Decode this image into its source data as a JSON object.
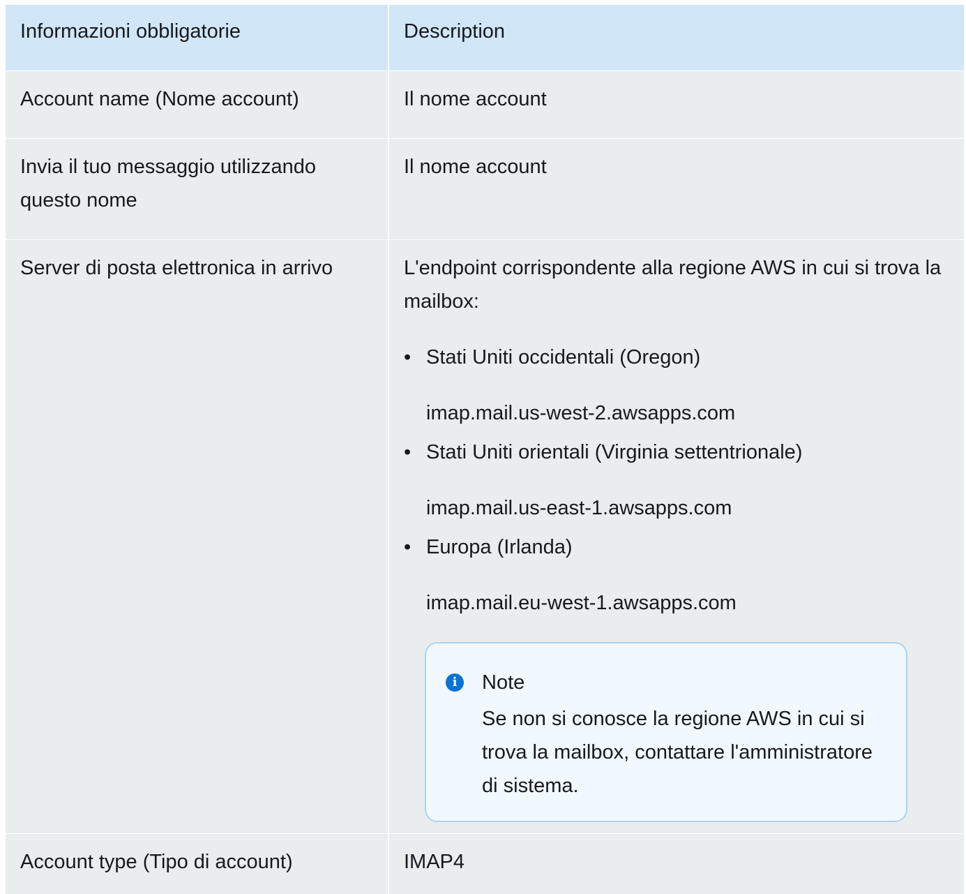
{
  "table": {
    "headers": [
      "Informazioni obbligatorie",
      "Description"
    ],
    "rows": [
      {
        "field": "Account name (Nome account)",
        "description": "Il nome account"
      },
      {
        "field": "Invia il tuo messaggio utilizzando questo nome",
        "description": "Il nome account"
      },
      {
        "field": "Server di posta elettronica in arrivo",
        "description": "L'endpoint corrispondente alla regione AWS in cui si trova la mailbox:",
        "endpoints": [
          {
            "region": "Stati Uniti occidentali (Oregon)",
            "host": "imap.mail.us-west-2.awsapps.com"
          },
          {
            "region": "Stati Uniti orientali (Virginia settentrionale)",
            "host": "imap.mail.us-east-1.awsapps.com"
          },
          {
            "region": "Europa (Irlanda)",
            "host": "imap.mail.eu-west-1.awsapps.com"
          }
        ],
        "note": {
          "icon": "info-icon",
          "title": "Note",
          "body": "Se non si conosce la regione AWS in cui si trova la mailbox, contattare l'amministratore di sistema."
        }
      },
      {
        "field": "Account type (Tipo di account)",
        "description": "IMAP4"
      }
    ]
  },
  "colors": {
    "header_bg": "#d1e6f7",
    "row_bg": "#eaeded",
    "note_bg": "#f1f8fe",
    "note_border": "#a8d4f5",
    "info_icon": "#0972d3"
  }
}
